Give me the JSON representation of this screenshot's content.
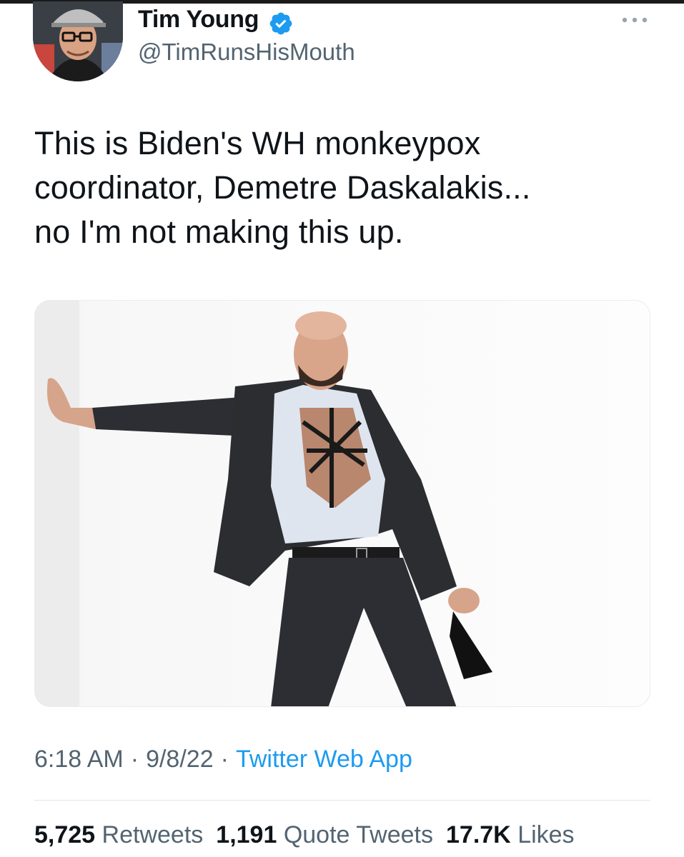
{
  "tweet": {
    "author": {
      "display_name": "Tim Young",
      "handle": "@TimRunsHisMouth",
      "verified": true
    },
    "text_lines": [
      "This is Biden's WH monkeypox",
      "coordinator,  Demetre Daskalakis...",
      "no I'm not making this up."
    ],
    "media": {
      "type": "photo"
    },
    "time": "6:18 AM",
    "date": "9/8/22",
    "separator": "·",
    "source": "Twitter Web App",
    "stats": {
      "retweets_count": "5,725",
      "retweets_label": "Retweets",
      "quotes_count": "1,191",
      "quotes_label": "Quote Tweets",
      "likes_count": "17.7K",
      "likes_label": "Likes"
    }
  },
  "colors": {
    "text_primary": "#0f1419",
    "text_secondary": "#536471",
    "link_blue": "#1d9bf0",
    "divider": "#e1e6ea"
  },
  "icons": {
    "verified": "verified-badge-icon",
    "more": "more-options-icon"
  }
}
